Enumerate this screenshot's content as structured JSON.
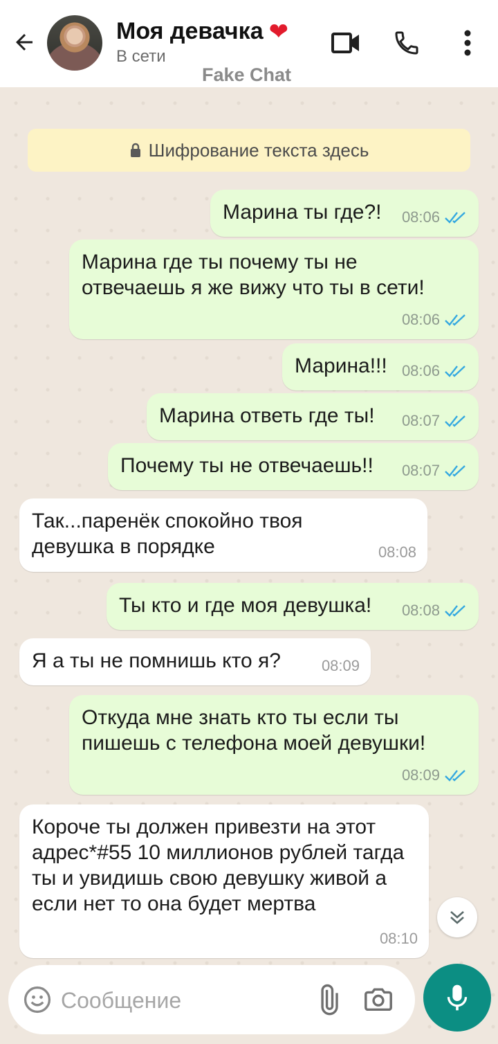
{
  "header": {
    "contact_name": "Моя девачка",
    "heart": "❤",
    "status": "В сети",
    "watermark": "Fake Chat",
    "icons": [
      "back-arrow-icon",
      "video-call-icon",
      "phone-icon",
      "more-vert-icon"
    ]
  },
  "encryption_notice": "Шифрование текста здесь",
  "messages": [
    {
      "dir": "out",
      "text": "Марина ты где?!",
      "time": "08:06",
      "read": true
    },
    {
      "dir": "out",
      "text": "Марина где ты почему ты не отвечаешь я же вижу что ты в сети!",
      "time": "08:06",
      "read": true
    },
    {
      "dir": "out",
      "text": "Марина!!!",
      "time": "08:06",
      "read": true
    },
    {
      "dir": "out",
      "text": "Марина ответь где ты!",
      "time": "08:07",
      "read": true
    },
    {
      "dir": "out",
      "text": "Почему ты не отвечаешь!!",
      "time": "08:07",
      "read": true
    },
    {
      "dir": "in",
      "text": "Так...паренёк спокойно твоя девушка в порядке",
      "time": "08:08"
    },
    {
      "dir": "out",
      "text": "Ты кто и где моя девушка!",
      "time": "08:08",
      "read": true
    },
    {
      "dir": "in",
      "text": "Я а ты не помнишь кто я?",
      "time": "08:09"
    },
    {
      "dir": "out",
      "text": "Откуда мне знать кто ты если ты пишешь с телефона моей девушки!",
      "time": "08:09",
      "read": true
    },
    {
      "dir": "in",
      "text": "Короче ты должен привезти на этот адрес*#55 10 миллионов рублей тагда ты и увидишь свою девушку живой а если нет то она будет мертва",
      "time": "08:10"
    }
  ],
  "input": {
    "placeholder": "Сообщение"
  },
  "colors": {
    "outgoing_bubble": "#e7fcd7",
    "incoming_bubble": "#ffffff",
    "accent": "#0c8e83",
    "read_ticks": "#34a8e0",
    "chat_background": "#efe7de"
  }
}
